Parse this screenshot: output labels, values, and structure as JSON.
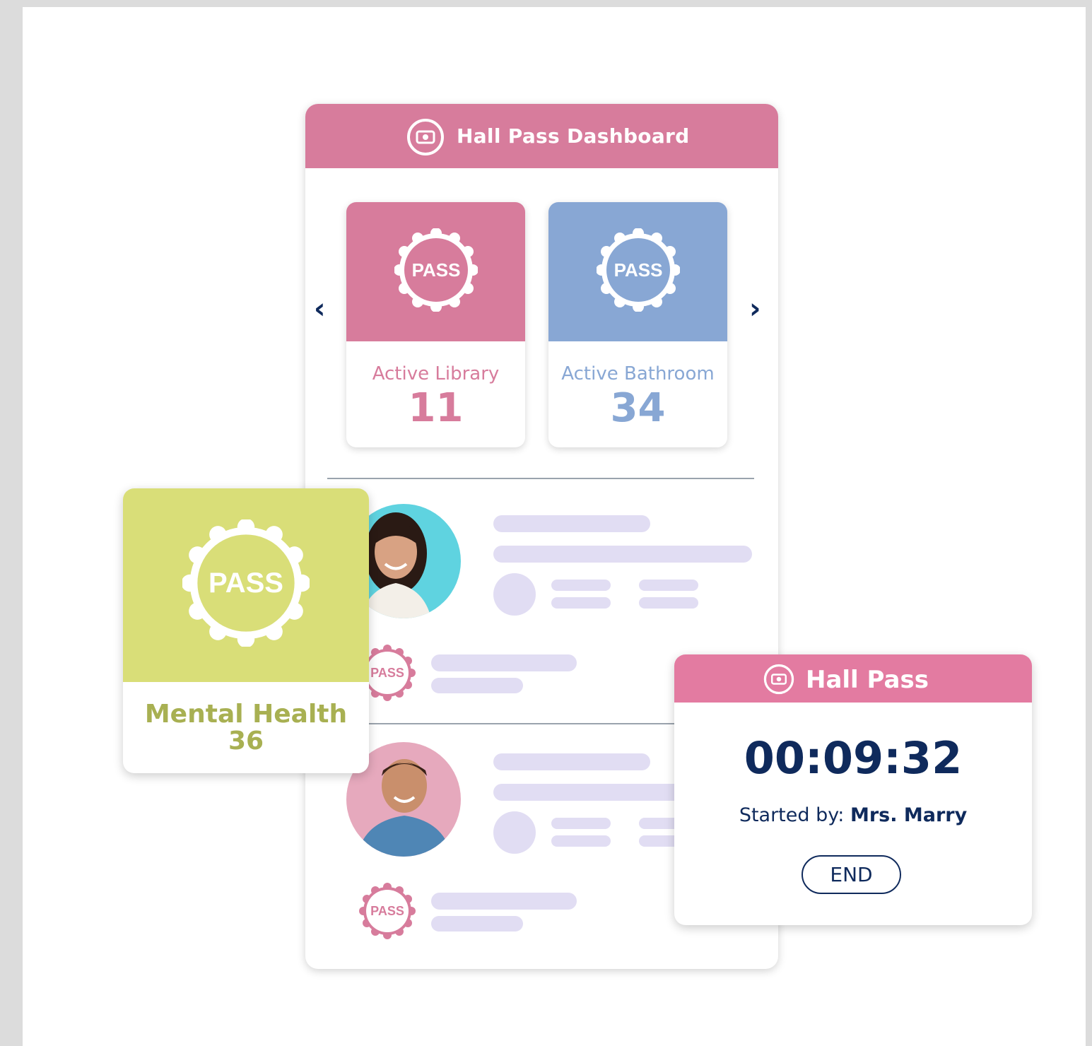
{
  "dashboard": {
    "title": "Hall Pass Dashboard",
    "icon": "ticket-icon",
    "prev_icon": "chevron-left-icon",
    "next_icon": "chevron-right-icon",
    "tiles": [
      {
        "badge": "PASS",
        "label": "Active Library",
        "count": "11",
        "color": "#d77c9c",
        "text_color": "#d77c9c"
      },
      {
        "badge": "PASS",
        "label": "Active Bathroom",
        "count": "34",
        "color": "#88a7d4",
        "text_color": "#88a7d4"
      }
    ],
    "list_items": [
      {
        "badge": "PASS",
        "avatar": "student-girl-avatar"
      },
      {
        "badge": "PASS",
        "avatar": "student-boy-avatar"
      }
    ]
  },
  "mental_health": {
    "badge": "PASS",
    "label": "Mental Health",
    "count": "36",
    "color": "#d9de78"
  },
  "hall_pass": {
    "title": "Hall Pass",
    "icon": "ticket-icon",
    "timer": "00:09:32",
    "started_prefix": "Started by:",
    "started_by": "Mrs. Marry",
    "end_label": "END",
    "color": "#e37ba1"
  }
}
